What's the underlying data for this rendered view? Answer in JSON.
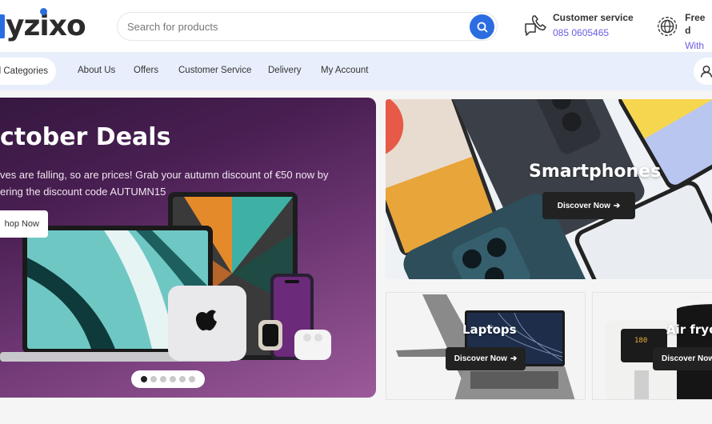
{
  "header": {
    "logo_text": "yzixo",
    "search": {
      "placeholder": "Search for products",
      "value": ""
    },
    "customer_service": {
      "title": "Customer service",
      "phone": "085 0605465"
    },
    "shipping": {
      "title": "Free d",
      "subtitle": "With a"
    },
    "accent_color": "#2b6de0"
  },
  "nav": {
    "categories_label": "l Categories",
    "items": [
      {
        "label": "About Us"
      },
      {
        "label": "Offers"
      },
      {
        "label": "Customer Service"
      },
      {
        "label": "Delivery"
      },
      {
        "label": "My Account"
      }
    ]
  },
  "hero": {
    "title": "ctober Deals",
    "description_line1": "ves are falling, so are prices! Grab your autumn discount of €50 now by",
    "description_line2": "ering the discount code AUTUMN15",
    "button_label": "hop Now",
    "slides_total": 6,
    "active_slide": 1
  },
  "cards": [
    {
      "title": "Smartphones",
      "button_label": "Discover Now"
    },
    {
      "title": "Laptops",
      "button_label": "Discover Now"
    },
    {
      "title": "Air fryer",
      "button_label": "Discover Now"
    }
  ],
  "icons": {
    "search": "search-icon",
    "customer_service": "phone-chat-icon",
    "shipping": "globe-icon",
    "account": "user-icon",
    "arrow": "arrow-right-icon"
  }
}
